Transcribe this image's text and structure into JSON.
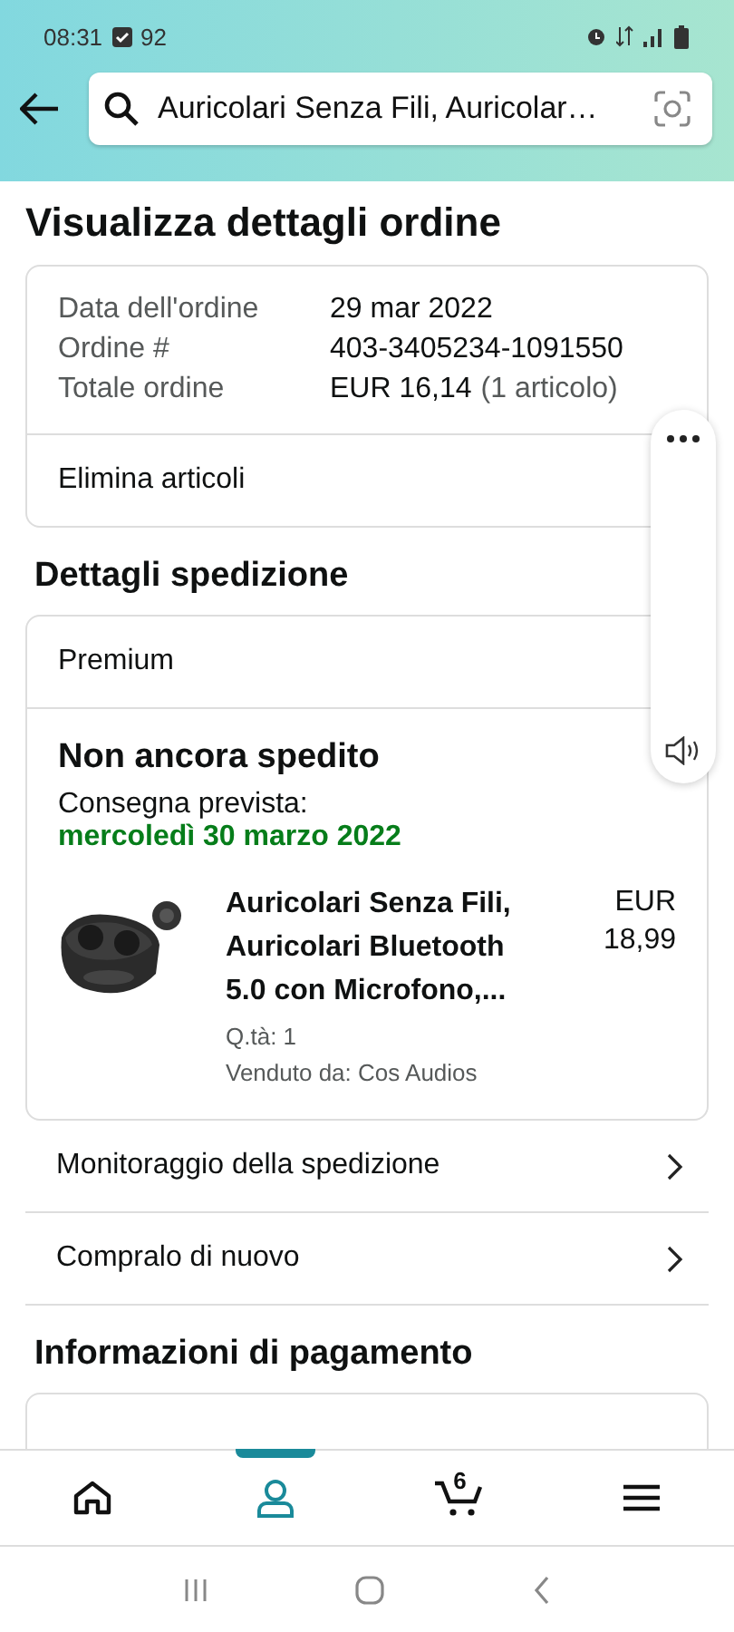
{
  "status_bar": {
    "time": "08:31",
    "notification_count": "92"
  },
  "search": {
    "value": "Auricolari Senza Fili, Auricolar…"
  },
  "page_title": "Visualizza dettagli ordine",
  "order_info": [
    {
      "label": "Data dell'ordine",
      "value": "29 mar 2022"
    },
    {
      "label": "Ordine #",
      "value": "403-3405234-1091550"
    },
    {
      "label": "Totale ordine",
      "value": "EUR 16,14",
      "note": "(1 articolo)"
    }
  ],
  "order_action": "Elimina articoli",
  "shipping": {
    "heading": "Dettagli spedizione",
    "method": "Premium",
    "status": "Non ancora spedito",
    "delivery_label": "Consegna prevista:",
    "delivery_date": "mercoledì 30 marzo 2022",
    "item": {
      "title": "Auricolari Senza Fili, Auricolari Bluetooth 5.0 con Microfono,...",
      "quantity": "Q.tà: 1",
      "seller": "Venduto da: Cos Audios",
      "price": "EUR 18,99"
    }
  },
  "links": [
    "Monitoraggio della spedizione",
    "Compralo di nuovo"
  ],
  "payment_heading": "Informazioni di pagamento",
  "nav_tabs": [
    {
      "kind": "home",
      "selected": false
    },
    {
      "kind": "account",
      "selected": true
    },
    {
      "kind": "cart",
      "selected": false,
      "badge": "6"
    },
    {
      "kind": "menu",
      "selected": false
    }
  ]
}
